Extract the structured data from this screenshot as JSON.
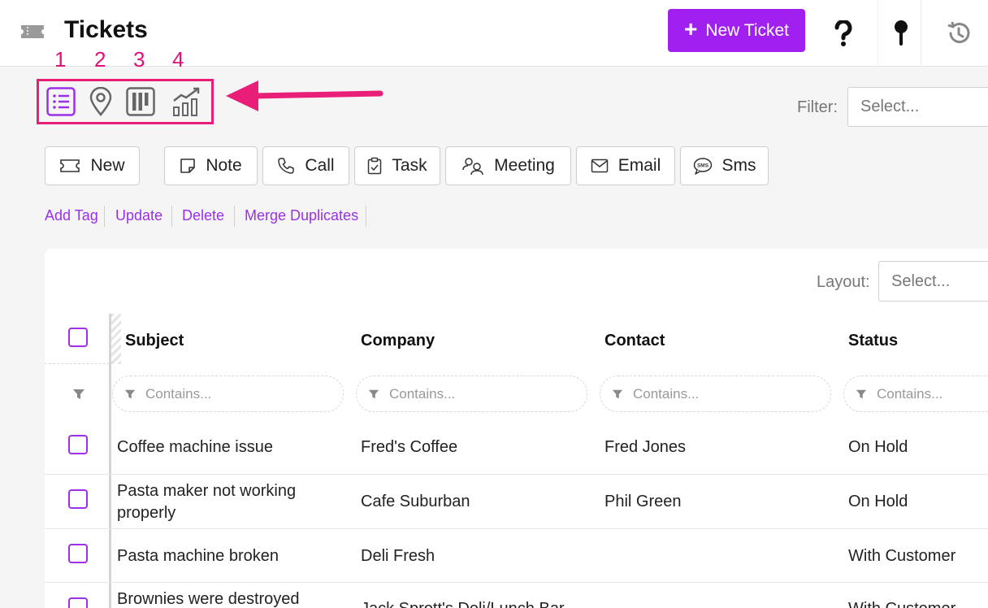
{
  "header": {
    "title": "Tickets",
    "new_ticket_label": "New Ticket",
    "icons": [
      "ticket-icon",
      "help-icon",
      "pin-icon",
      "history-icon"
    ]
  },
  "annotation": {
    "numbers": [
      "1",
      "2",
      "3",
      "4"
    ],
    "color": "#e91e78"
  },
  "view_switcher": [
    "list-view-icon",
    "map-view-icon",
    "board-view-icon",
    "chart-view-icon"
  ],
  "filter": {
    "label": "Filter:",
    "placeholder": "Select..."
  },
  "actions": [
    "New",
    "Note",
    "Call",
    "Task",
    "Meeting",
    "Email",
    "Sms"
  ],
  "links": [
    "Add Tag",
    "Update",
    "Delete",
    "Merge Duplicates"
  ],
  "layout": {
    "label": "Layout:",
    "placeholder": "Select..."
  },
  "table": {
    "columns": [
      "Subject",
      "Company",
      "Contact",
      "Status"
    ],
    "filter_placeholder": "Contains...",
    "rows": [
      {
        "subject": "Coffee machine issue",
        "company": "Fred's Coffee",
        "contact": "Fred Jones",
        "status": "On Hold"
      },
      {
        "subject": "Pasta maker not working properly",
        "company": "Cafe Suburban",
        "contact": "Phil Green",
        "status": "On Hold"
      },
      {
        "subject": "Pasta machine broken",
        "company": "Deli Fresh",
        "contact": "",
        "status": "With Customer"
      },
      {
        "subject": "Brownies were destroyed",
        "company": "Jack Sprott's Deli/Lunch Bar",
        "contact": "",
        "status": "With Customer"
      }
    ]
  },
  "colors": {
    "accent": "#a020f0",
    "link": "#9b30e8",
    "annotation": "#e0107a"
  }
}
